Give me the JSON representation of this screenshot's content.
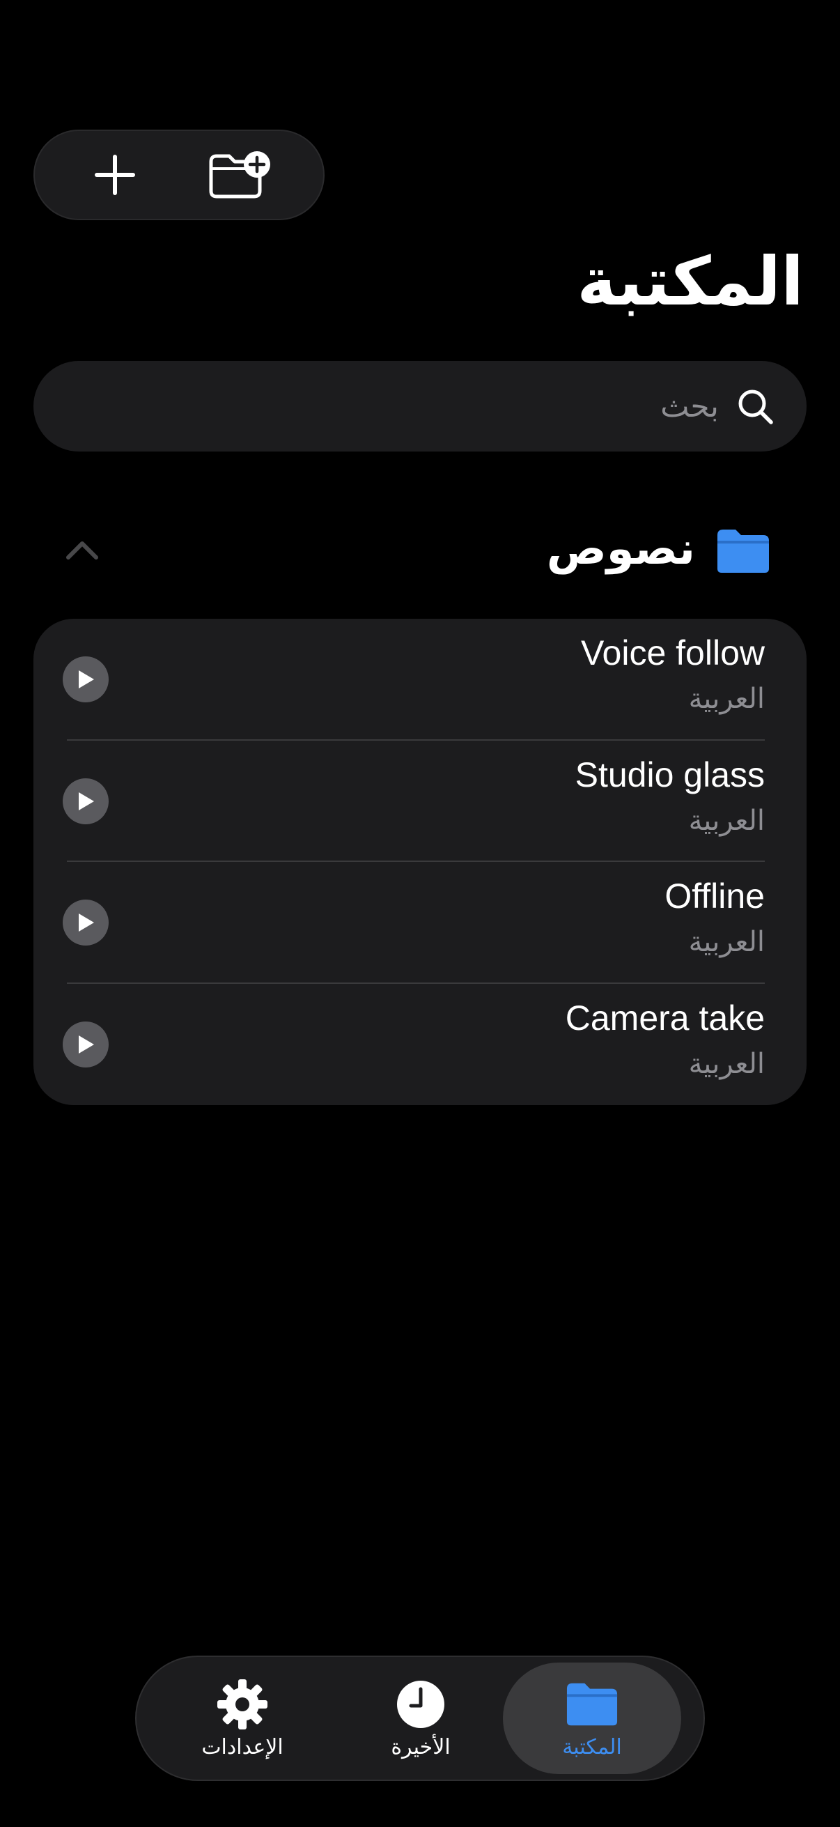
{
  "top_actions": {
    "icons": [
      "plus-icon",
      "folder-add-icon"
    ]
  },
  "header": {
    "title": "المكتبة"
  },
  "search": {
    "placeholder": "بحث",
    "value": ""
  },
  "section": {
    "title": "نصوص",
    "icon": "folder-icon",
    "collapse_icon": "chevron-up-icon"
  },
  "items": [
    {
      "title": "Voice follow",
      "subtitle": "العربية"
    },
    {
      "title": "Studio glass",
      "subtitle": "العربية"
    },
    {
      "title": "Offline",
      "subtitle": "العربية"
    },
    {
      "title": "Camera take",
      "subtitle": "العربية"
    }
  ],
  "tabbar": {
    "tabs": [
      {
        "label": "الإعدادات",
        "icon": "gear-icon"
      },
      {
        "label": "الأخيرة",
        "icon": "clock-icon"
      },
      {
        "label": "المكتبة",
        "icon": "folder-icon",
        "selected": true
      }
    ]
  },
  "colors": {
    "accent": "#3d8ef2",
    "background": "#000000",
    "card": "#1c1c1e",
    "secondary_text": "#8e8e93"
  }
}
